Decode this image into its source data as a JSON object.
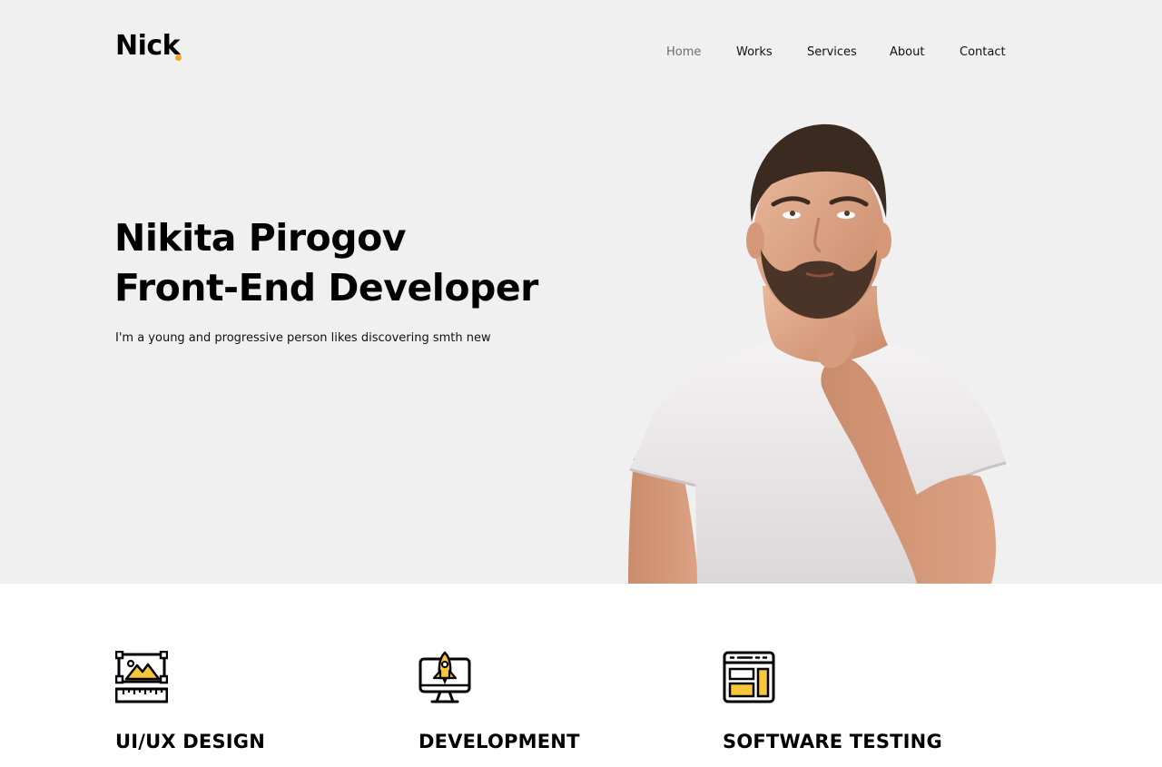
{
  "brand": {
    "name": "Nick",
    "dot_color": "#f7a51b"
  },
  "nav": {
    "items": [
      {
        "label": "Home",
        "active": true
      },
      {
        "label": "Works",
        "active": false
      },
      {
        "label": "Services",
        "active": false
      },
      {
        "label": "About",
        "active": false
      },
      {
        "label": "Contact",
        "active": false
      }
    ]
  },
  "hero": {
    "name": "Nikita Pirogov",
    "role": "Front-End Developer",
    "tagline": "I'm a young and progressive person likes discovering smth new",
    "background": "#f1f0f0",
    "image": "portrait-photo"
  },
  "services": {
    "accent_color": "#f8c63a",
    "items": [
      {
        "title": "UI/UX DESIGN",
        "icon": "design-frame-icon"
      },
      {
        "title": "DEVELOPMENT",
        "icon": "rocket-monitor-icon"
      },
      {
        "title": "SOFTWARE TESTING",
        "icon": "browser-layout-icon"
      }
    ]
  }
}
